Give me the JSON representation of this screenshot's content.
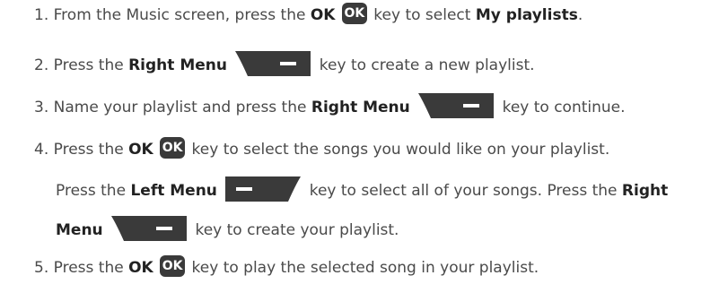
{
  "steps": [
    {
      "number": "1.",
      "segments": [
        "From the Music screen, press the",
        "OK",
        "key to select",
        "My playlists",
        "."
      ]
    },
    {
      "number": "2.",
      "segments": [
        "Press the",
        "Right Menu",
        "key to create a new playlist."
      ]
    },
    {
      "number": "3.",
      "segments": [
        "Name your playlist and press the",
        "Right Menu",
        "key to continue."
      ]
    },
    {
      "number": "4.",
      "segments": [
        "Press the",
        "OK",
        "key to select the songs you would like on your playlist.",
        "Press the",
        "Left Menu",
        "key to select all of your songs. Press the",
        "Right",
        "Menu",
        "key to create your playlist."
      ]
    },
    {
      "number": "5.",
      "segments": [
        "Press the",
        "OK",
        "key to play the selected song in your playlist."
      ]
    }
  ],
  "icons": {
    "ok_key_label": "OK"
  },
  "colors": {
    "text": "#4a4a4a",
    "bold_text": "#222222",
    "key_fill": "#3a3a3a",
    "key_symbol": "#ffffff"
  }
}
